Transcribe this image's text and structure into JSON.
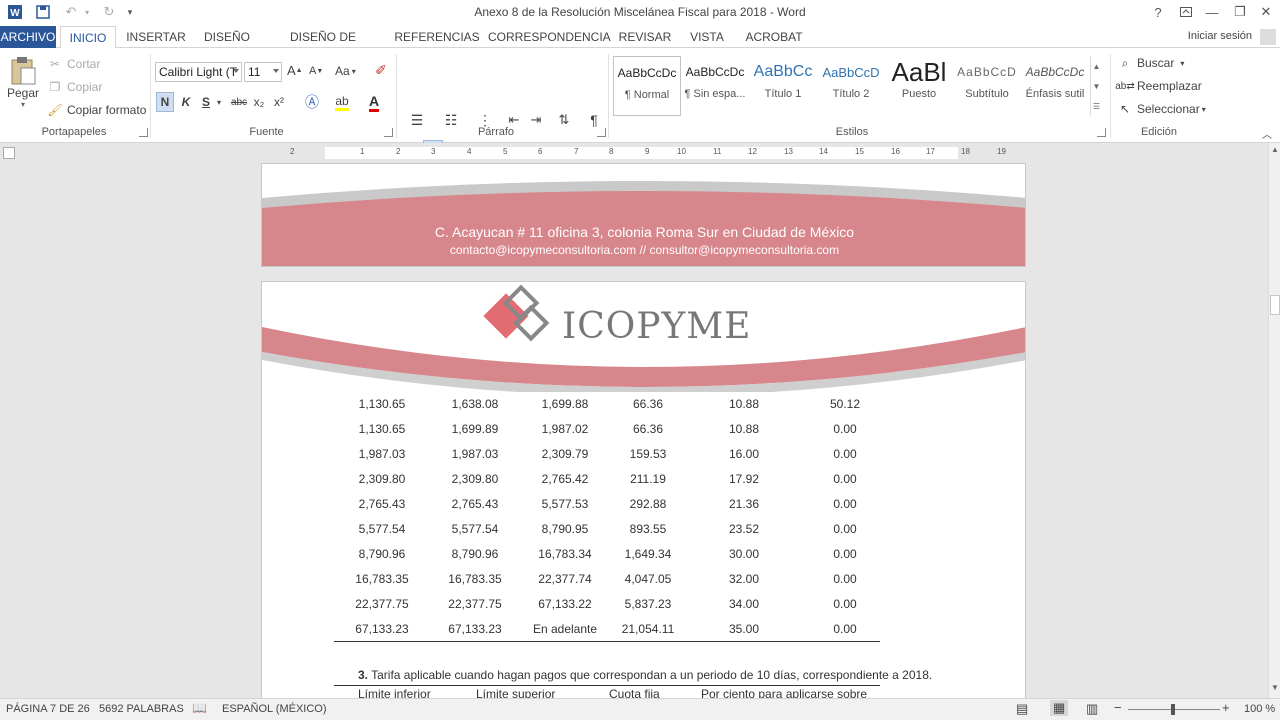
{
  "titlebar": {
    "title": "Anexo 8 de la Resolución Miscelánea Fiscal para 2018 - Word",
    "help": "?",
    "minimize": "—",
    "restore": "❐",
    "close": "✕"
  },
  "tabs": {
    "file": "ARCHIVO",
    "items": [
      "INICIO",
      "INSERTAR",
      "DISEÑO",
      "DISEÑO DE PÁGINA",
      "REFERENCIAS",
      "CORRESPONDENCIA",
      "REVISAR",
      "VISTA",
      "ACROBAT"
    ],
    "signin": "Iniciar sesión"
  },
  "ribbon": {
    "clipboard": {
      "paste": "Pegar",
      "cut": "Cortar",
      "copy": "Copiar",
      "format_painter": "Copiar formato",
      "label": "Portapapeles"
    },
    "font": {
      "name": "Calibri Light (T",
      "size": "11",
      "bold": "N",
      "italic": "K",
      "underline": "S",
      "strike": "abc",
      "subscript": "x₂",
      "superscript": "x²",
      "case": "Aa",
      "grow": "A",
      "shrink": "A",
      "label": "Fuente"
    },
    "paragraph": {
      "label": "Párrafo",
      "pilcrow": "¶"
    },
    "styles": {
      "label": "Estilos",
      "items": [
        {
          "preview": "AaBbCcDc",
          "name": "¶ Normal"
        },
        {
          "preview": "AaBbCcDc",
          "name": "¶ Sin espa..."
        },
        {
          "preview": "AaBbCc",
          "name": "Título 1"
        },
        {
          "preview": "AaBbCcD",
          "name": "Título 2"
        },
        {
          "preview": "AaBl",
          "name": "Puesto"
        },
        {
          "preview": "AaBbCcD",
          "name": "Subtítulo"
        },
        {
          "preview": "AaBbCcDc",
          "name": "Énfasis sutil"
        }
      ]
    },
    "editing": {
      "find": "Buscar",
      "replace": "Reemplazar",
      "select": "Seleccionar",
      "label": "Edición"
    }
  },
  "ruler": {
    "ticks": [
      "2",
      "1",
      "1",
      "2",
      "3",
      "4",
      "5",
      "6",
      "7",
      "8",
      "9",
      "10",
      "11",
      "12",
      "13",
      "14",
      "15",
      "16",
      "17",
      "18",
      "19"
    ]
  },
  "document": {
    "footer_address": "C. Acayucan # 11 oficina 3, colonia Roma Sur en Ciudad de México",
    "footer_contact": "contacto@icopymeconsultoria.com   //   consultor@icopymeconsultoria.com",
    "logo_text": "ICOPYME",
    "table_rows": [
      [
        "1,130.65",
        "1,638.08",
        "1,699.88",
        "66.36",
        "10.88",
        "50.12"
      ],
      [
        "1,130.65",
        "1,699.89",
        "1,987.02",
        "66.36",
        "10.88",
        "0.00"
      ],
      [
        "1,987.03",
        "1,987.03",
        "2,309.79",
        "159.53",
        "16.00",
        "0.00"
      ],
      [
        "2,309.80",
        "2,309.80",
        "2,765.42",
        "211.19",
        "17.92",
        "0.00"
      ],
      [
        "2,765.43",
        "2,765.43",
        "5,577.53",
        "292.88",
        "21.36",
        "0.00"
      ],
      [
        "5,577.54",
        "5,577.54",
        "8,790.95",
        "893.55",
        "23.52",
        "0.00"
      ],
      [
        "8,790.96",
        "8,790.96",
        "16,783.34",
        "1,649.34",
        "30.00",
        "0.00"
      ],
      [
        "16,783.35",
        "16,783.35",
        "22,377.74",
        "4,047.05",
        "32.00",
        "0.00"
      ],
      [
        "22,377.75",
        "22,377.75",
        "67,133.22",
        "5,837.23",
        "34.00",
        "0.00"
      ],
      [
        "67,133.23",
        "67,133.23",
        "En adelante",
        "21,054.11",
        "35.00",
        "0.00"
      ]
    ],
    "section3_num": "3.",
    "section3_text": " Tarifa aplicable cuando hagan pagos que correspondan a un periodo de 10 días, correspondiente a 2018.",
    "next_headers": [
      "Límite inferior",
      "Límite superior",
      "Cuota fija",
      "Por ciento para aplicarse sobre"
    ]
  },
  "statusbar": {
    "page": "PÁGINA 7 DE 26",
    "words": "5692 PALABRAS",
    "language": "ESPAÑOL (MÉXICO)",
    "zoom": "100 %",
    "zoom_minus": "−",
    "zoom_plus": "+"
  }
}
